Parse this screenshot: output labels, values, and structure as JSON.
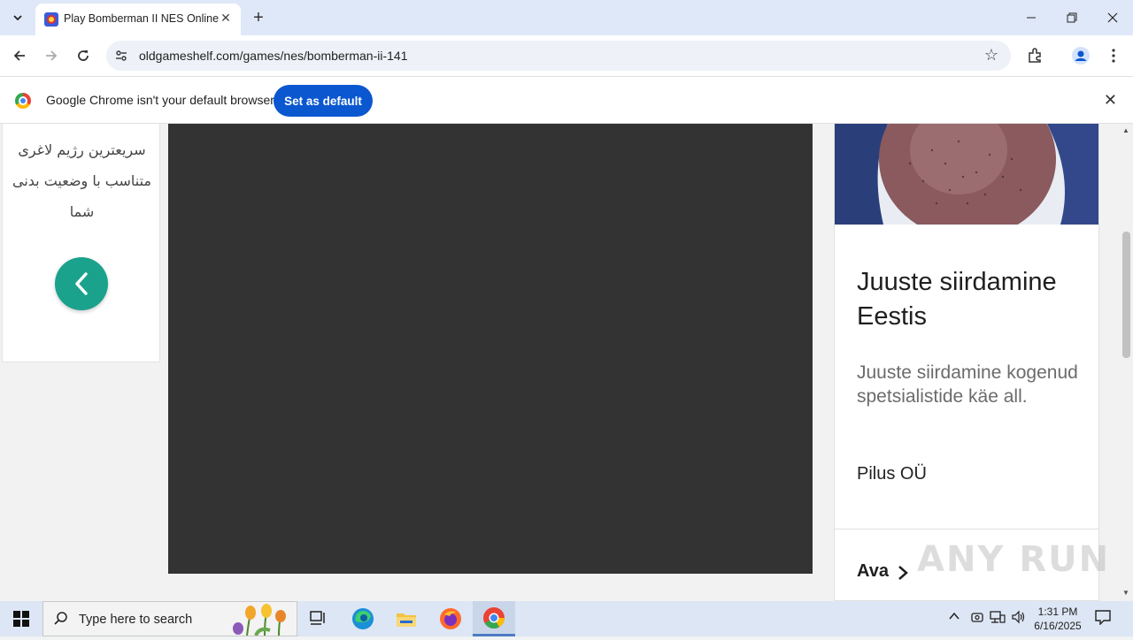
{
  "browser": {
    "tab": {
      "title": "Play Bomberman II NES Online"
    },
    "url": "oldgameshelf.com/games/nes/bomberman-ii-141",
    "infobar": {
      "message": "Google Chrome isn't your default browser",
      "button": "Set as default"
    }
  },
  "page": {
    "left_ad": {
      "text": "سریعترین رژیم لاغری متناسب با وضعیت بدنی شما"
    },
    "right_ad": {
      "headline": "Juuste siirdamine Eestis",
      "description": "Juuste siirdamine kogenud spetsialistide käe all.",
      "advertiser": "Pilus OÜ",
      "cta": "Ava"
    },
    "watermark": "ANY RUN"
  },
  "taskbar": {
    "search_placeholder": "Type here to search",
    "time": "1:31 PM",
    "date": "6/16/2025"
  },
  "colors": {
    "accent_button": "#0b57d0",
    "ad_button": "#1aa28c",
    "game_bg": "#333333"
  }
}
